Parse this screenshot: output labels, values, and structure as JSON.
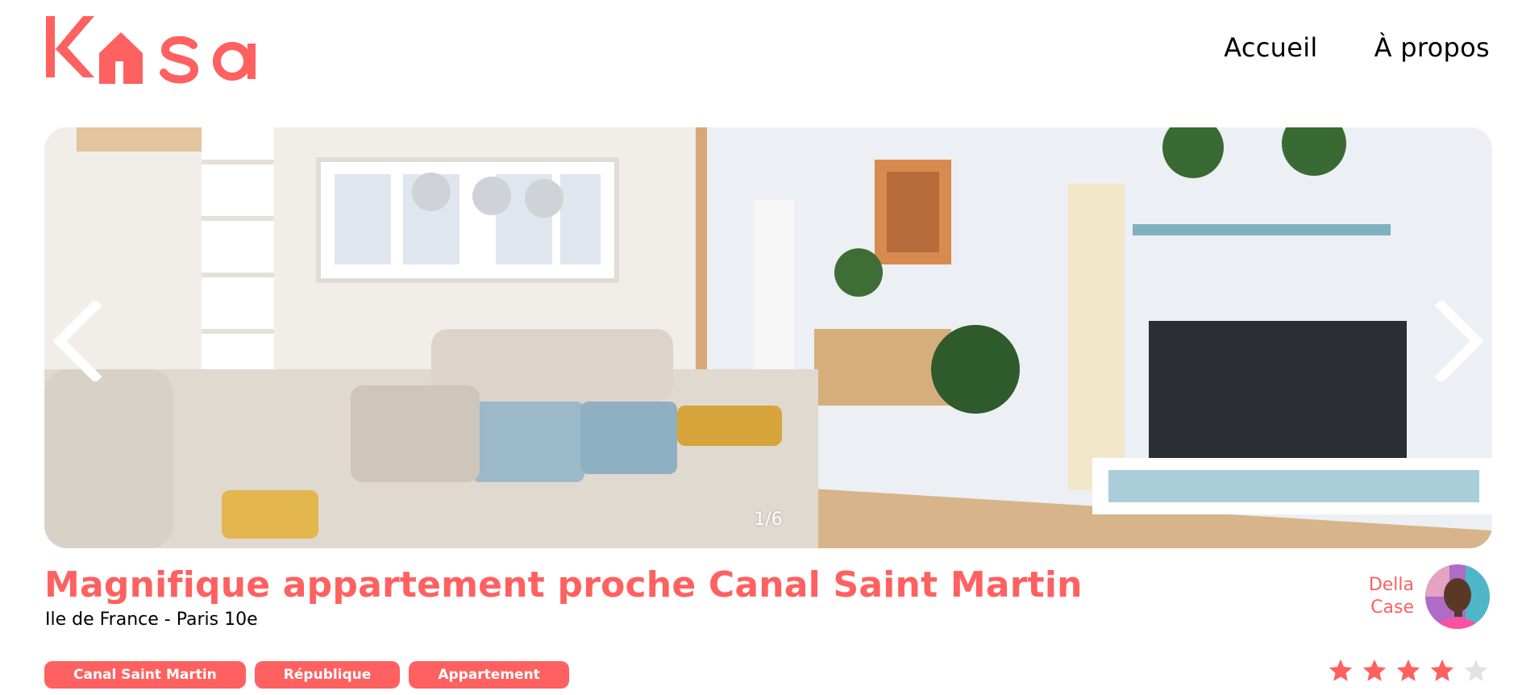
{
  "logo": {
    "text": "Kasa",
    "color": "#ff6060"
  },
  "nav": {
    "home_label": "Accueil",
    "about_label": "À propos"
  },
  "gallery": {
    "counter": "1/6",
    "prev_icon": "chevron-left-icon",
    "next_icon": "chevron-right-icon"
  },
  "listing": {
    "title": "Magnifique appartement proche Canal Saint Martin",
    "location": "Ile de France - Paris 10e",
    "tags": [
      "Canal Saint Martin",
      "République",
      "Appartement"
    ],
    "rating": 4,
    "rating_max": 5
  },
  "host": {
    "first_name": "Della",
    "last_name": "Case"
  },
  "colors": {
    "accent": "#ff6060",
    "star_off": "#e3e3e3"
  }
}
